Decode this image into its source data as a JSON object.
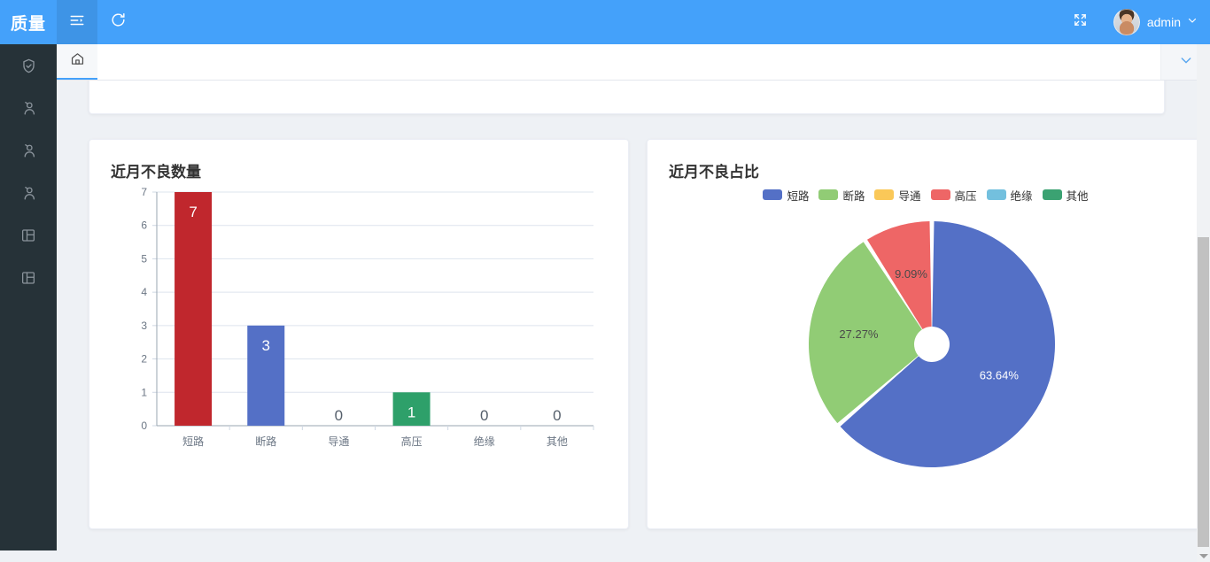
{
  "app": {
    "logo": "质量",
    "username": "admin"
  },
  "header": {
    "menu_toggle_icon": "indent-menu-icon",
    "refresh_icon": "refresh-icon",
    "fullscreen_icon": "fullscreen-icon",
    "avatar_icon": "avatar",
    "caret_icon": "chevron-down-icon"
  },
  "sidebar": {
    "items": [
      {
        "icon": "shield-check-icon",
        "name": "sidebar-item-quality"
      },
      {
        "icon": "user-icon",
        "name": "sidebar-item-user-1"
      },
      {
        "icon": "user-icon",
        "name": "sidebar-item-user-2"
      },
      {
        "icon": "user-icon",
        "name": "sidebar-item-user-3"
      },
      {
        "icon": "layout-panel-icon",
        "name": "sidebar-item-panel-1"
      },
      {
        "icon": "layout-panel-icon",
        "name": "sidebar-item-panel-2"
      }
    ]
  },
  "tabbar": {
    "tabs": [
      {
        "icon": "home-icon",
        "label": "",
        "active": true
      }
    ],
    "dropdown_icon": "chevron-down-icon"
  },
  "chart_data": [
    {
      "type": "bar",
      "title": "近月不良数量",
      "categories": [
        "短路",
        "断路",
        "导通",
        "高压",
        "绝缘",
        "其他"
      ],
      "values": [
        7,
        3,
        0,
        1,
        0,
        0
      ],
      "colors": [
        "#c0272d",
        "#5470c6",
        "#fac858",
        "#2ea06a",
        "#73c0de",
        "#3ba272"
      ],
      "ylim": [
        0,
        7
      ],
      "yticks": [
        0,
        1,
        2,
        3,
        4,
        5,
        6,
        7
      ],
      "xlabel": "",
      "ylabel": "",
      "grid": true,
      "legend": "none",
      "data_labels": [
        "7",
        "3",
        "0",
        "1",
        "0",
        "0"
      ]
    },
    {
      "type": "pie",
      "title": "近月不良占比",
      "categories": [
        "短路",
        "断路",
        "导通",
        "高压",
        "绝缘",
        "其他"
      ],
      "values": [
        63.64,
        27.27,
        0,
        9.09,
        0,
        0
      ],
      "labels": [
        "63.64%",
        "27.27%",
        "",
        "9.09%",
        "",
        ""
      ],
      "colors": [
        "#5470c6",
        "#91cc75",
        "#fac858",
        "#ee6666",
        "#73c0de",
        "#3ba272"
      ],
      "legend": "top",
      "donut_hole": true
    }
  ]
}
